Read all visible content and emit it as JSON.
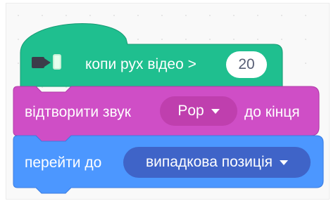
{
  "blocks": {
    "hat": {
      "label": "копи рух відео >",
      "value": "20",
      "icon": "video-sensing-icon",
      "color": "#1fbf8f"
    },
    "sound": {
      "label_before": "відтворити звук",
      "dropdown_value": "Pop",
      "label_after": "до кінця",
      "color": "#cf4ec6"
    },
    "motion": {
      "label": "перейти до",
      "dropdown_value": "випадкова позиція",
      "color": "#4c97ff"
    }
  }
}
